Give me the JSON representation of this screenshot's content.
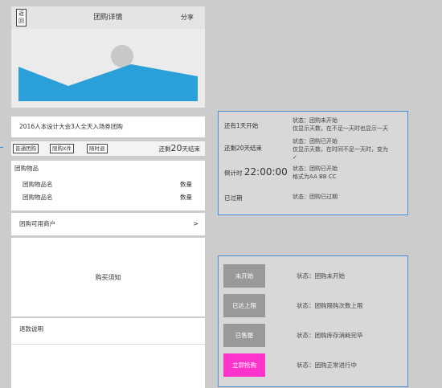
{
  "header": {
    "back_label": "返回",
    "title": "团购详情",
    "share_label": "分享"
  },
  "product": {
    "title": "2016人本设计大会3人全天入场券团购",
    "tags": [
      "普通团购",
      "限购X件",
      "随时退"
    ],
    "end_prefix": "还剩",
    "end_days": "20",
    "end_suffix": "天结束"
  },
  "goods": {
    "heading": "团购物品",
    "items": [
      {
        "name": "团购物品名",
        "qty": "数量"
      },
      {
        "name": "团购物品名",
        "qty": "数量"
      }
    ]
  },
  "merchants": {
    "label": "团购可用商户",
    "chevron": ">"
  },
  "notice": {
    "label": "购买须知"
  },
  "refund": {
    "label": "退款说明"
  },
  "states_timing": [
    {
      "label": "还有1天开始",
      "state_lines": [
        "状态：团购未开始",
        "仅显示天数，在不足一天时也显示一天"
      ]
    },
    {
      "label": "还剩20天结束",
      "state_lines": [
        "状态：团购已开始",
        "仅显示天数，在时间不足一天时，变为",
        "✓"
      ]
    },
    {
      "label_prefix": "倒计时",
      "label_time": "22:00:00",
      "state_lines": [
        "状态：团购已开始",
        "格式为AA BB CC"
      ]
    },
    {
      "label": "已过期",
      "state_lines": [
        "状态：团购已过期"
      ]
    }
  ],
  "states_buttons": [
    {
      "button": "未开始",
      "desc": "状态：团购未开始"
    },
    {
      "button": "已达上限",
      "desc": "状态：团购限购次数上限"
    },
    {
      "button": "已售罄",
      "desc": "状态：团购库存消耗完毕"
    },
    {
      "button": "立即抢购",
      "desc": "状态：团购正常进行中"
    }
  ],
  "colors": {
    "accent_border": "#4a90d9",
    "buy_button": "#ff33cc",
    "disabled_button": "#999999",
    "banner_shape": "#2a9fd8"
  }
}
